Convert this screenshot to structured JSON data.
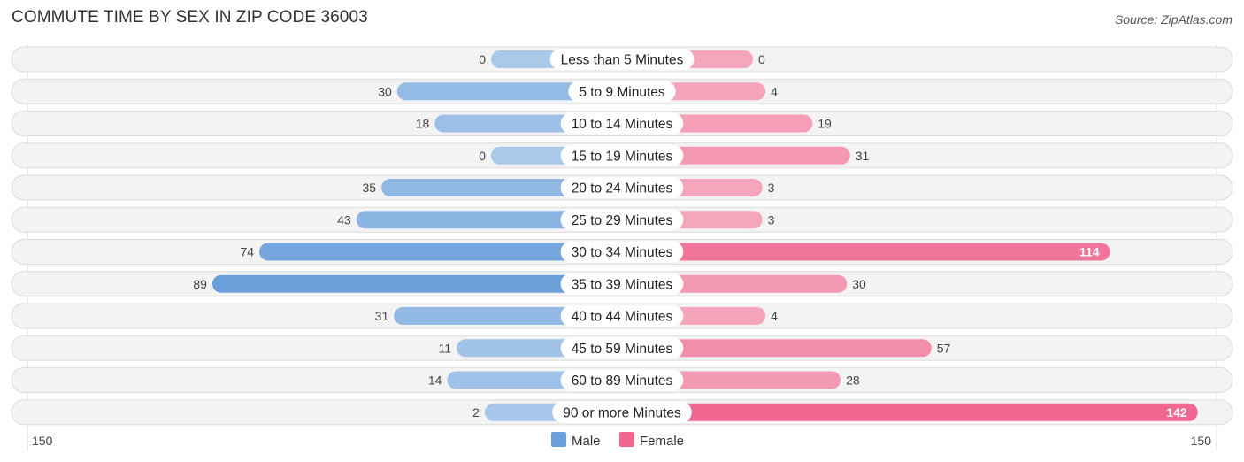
{
  "header": {
    "title": "COMMUTE TIME BY SEX IN ZIP CODE 36003",
    "source": "Source: ZipAtlas.com"
  },
  "chart_data": {
    "type": "bar",
    "orientation": "horizontal-diverging",
    "title": "COMMUTE TIME BY SEX IN ZIP CODE 36003",
    "categories": [
      "Less than 5 Minutes",
      "5 to 9 Minutes",
      "10 to 14 Minutes",
      "15 to 19 Minutes",
      "20 to 24 Minutes",
      "25 to 29 Minutes",
      "30 to 34 Minutes",
      "35 to 39 Minutes",
      "40 to 44 Minutes",
      "45 to 59 Minutes",
      "60 to 89 Minutes",
      "90 or more Minutes"
    ],
    "series": [
      {
        "name": "Male",
        "color": "#6aa0db",
        "light_color": "#a9c8ea",
        "values": [
          0,
          30,
          18,
          0,
          35,
          43,
          74,
          89,
          31,
          11,
          14,
          2
        ]
      },
      {
        "name": "Female",
        "color": "#f06892",
        "light_color": "#f5a6bd",
        "values": [
          0,
          4,
          19,
          31,
          3,
          3,
          114,
          30,
          4,
          57,
          28,
          142
        ]
      }
    ],
    "axis_min_label": "150",
    "axis_max_label": "150",
    "xlim": [
      -150,
      150
    ],
    "legend_position": "bottom-center"
  }
}
